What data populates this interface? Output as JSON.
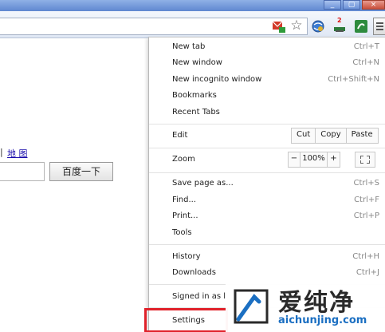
{
  "window": {
    "minimize": "_",
    "maximize": "▢",
    "close": "×"
  },
  "page": {
    "pipe": "|",
    "map_link": "地 图",
    "search_button": "百度一下"
  },
  "menu": {
    "items": [
      {
        "label": "New tab",
        "shortcut": "Ctrl+T"
      },
      {
        "label": "New window",
        "shortcut": "Ctrl+N"
      },
      {
        "label": "New incognito window",
        "shortcut": "Ctrl+Shift+N"
      },
      {
        "label": "Bookmarks",
        "shortcut": ""
      },
      {
        "label": "Recent Tabs",
        "shortcut": ""
      }
    ],
    "edit": {
      "label": "Edit",
      "cut": "Cut",
      "copy": "Copy",
      "paste": "Paste"
    },
    "zoom": {
      "label": "Zoom",
      "minus": "−",
      "value": "100%",
      "plus": "+"
    },
    "tools": [
      {
        "label": "Save page as...",
        "shortcut": "Ctrl+S"
      },
      {
        "label": "Find...",
        "shortcut": "Ctrl+F"
      },
      {
        "label": "Print...",
        "shortcut": "Ctrl+P"
      },
      {
        "label": "Tools",
        "shortcut": ""
      }
    ],
    "history": [
      {
        "label": "History",
        "shortcut": "Ctrl+H"
      },
      {
        "label": "Downloads",
        "shortcut": "Ctrl+J"
      }
    ],
    "signed_in": "Signed in as l",
    "settings": "Settings"
  },
  "toolbar": {
    "badge": "2"
  },
  "watermark": {
    "title": "爱纯净",
    "url": "aichunjing.com"
  },
  "colors": {
    "highlight": "#e0212a",
    "link": "#1a0dab",
    "watermark_url": "#1b6fc2"
  }
}
